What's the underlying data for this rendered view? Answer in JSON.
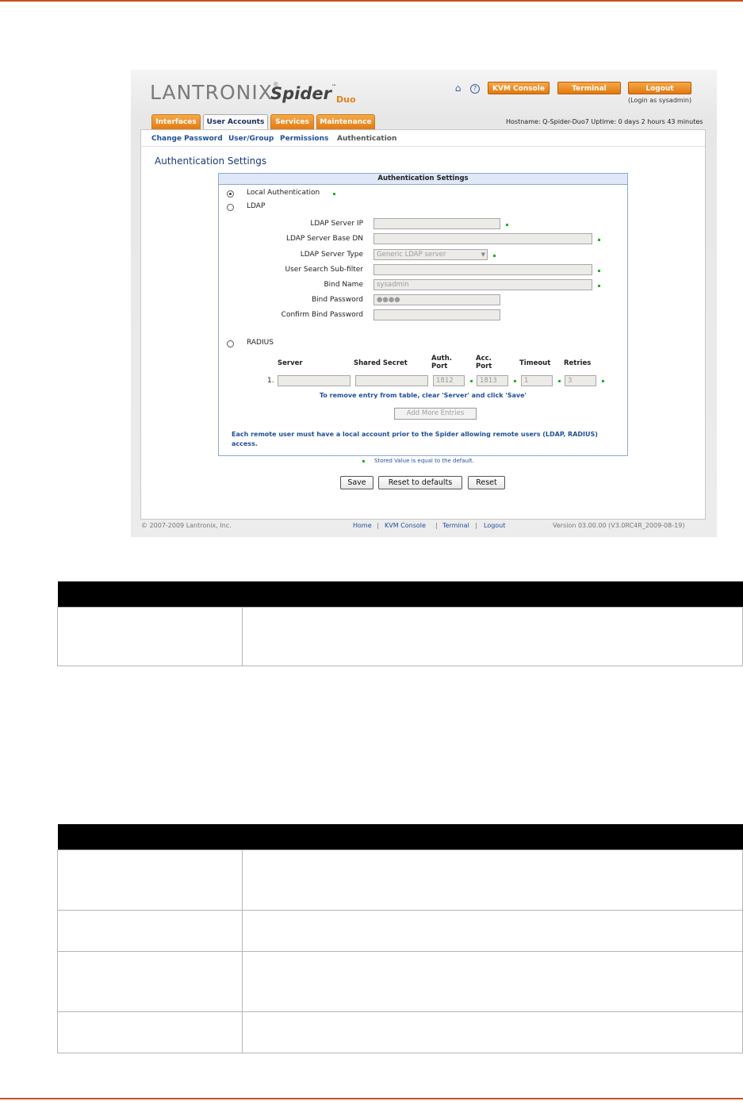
{
  "app": {
    "brand_name": "LANTRONIX",
    "product_name": "Spider",
    "product_suffix": "Duo",
    "toolbar": {
      "kvm_console": "KVM Console",
      "terminal": "Terminal",
      "logout": "Logout",
      "login_as": "(Login as sysadmin)"
    },
    "tabs": [
      "Interfaces",
      "User Accounts",
      "Services",
      "Maintenance"
    ],
    "active_tab": "User Accounts",
    "host_info": "Hostname: Q-Spider-Duo7   Uptime: 0 days 2 hours 43 minutes",
    "subnav": [
      "Change Password",
      "User/Group",
      "Permissions",
      "Authentication"
    ],
    "page_title": "Authentication Settings",
    "box_title": "Authentication Settings",
    "local_auth_label": "Local Authentication",
    "ldap_label": "LDAP",
    "ldap_fields": {
      "server_ip": {
        "label": "LDAP Server IP",
        "value": ""
      },
      "base_dn": {
        "label": "LDAP Server Base DN",
        "value": ""
      },
      "server_type": {
        "label": "LDAP Server Type",
        "value": "Generic LDAP server"
      },
      "search_subfilter": {
        "label": "User Search Sub-filter",
        "value": ""
      },
      "bind_name": {
        "label": "Bind Name",
        "value": "sysadmin"
      },
      "bind_password": {
        "label": "Bind Password",
        "value": "●●●●"
      },
      "confirm_bind_password": {
        "label": "Confirm Bind Password",
        "value": ""
      }
    },
    "radius_label": "RADIUS",
    "radius_headers": {
      "server": "Server",
      "shared_secret": "Shared Secret",
      "auth_port": "Auth. Port",
      "acc_port": "Acc. Port",
      "timeout": "Timeout",
      "retries": "Retries"
    },
    "radius_row": {
      "index": "1.",
      "server": "",
      "shared_secret": "",
      "auth_port": "1812",
      "acc_port": "1813",
      "timeout": "1",
      "retries": "3"
    },
    "remove_note": "To remove entry from table, clear 'Server' and click 'Save'",
    "add_more_label": "Add More Entries",
    "remote_note": "Each remote user must have a local account prior to the Spider allowing remote users (LDAP, RADIUS) access.",
    "stored_note": "Stored Value is equal to the default.",
    "buttons": {
      "save": "Save",
      "reset_defaults": "Reset to defaults",
      "reset": "Reset"
    },
    "footer": {
      "copyright": "© 2007-2009 Lantronix, Inc.",
      "links": [
        "Home",
        "KVM Console",
        "Terminal",
        "Logout"
      ],
      "version": "Version 03.00.00 (V3.0RC4R_2009-08-19)"
    }
  },
  "colors": {
    "accent_orange": "#e87f1a",
    "link_blue": "#1f4f9a",
    "default_marker_green": "#22b022",
    "page_rule": "#c8501e"
  }
}
